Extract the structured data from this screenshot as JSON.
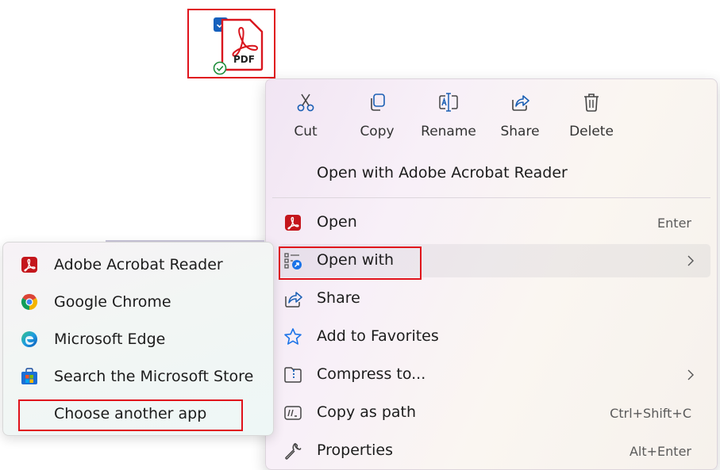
{
  "file": {
    "badge": "PDF"
  },
  "quick_actions": [
    {
      "label": "Cut",
      "icon": "scissors-icon"
    },
    {
      "label": "Copy",
      "icon": "copy-icon"
    },
    {
      "label": "Rename",
      "icon": "rename-icon"
    },
    {
      "label": "Share",
      "icon": "share-icon"
    },
    {
      "label": "Delete",
      "icon": "trash-icon"
    }
  ],
  "menu": {
    "default_action": "Open with Adobe Acrobat Reader",
    "items": [
      {
        "label": "Open",
        "shortcut": "Enter",
        "icon": "acrobat-icon"
      },
      {
        "label": "Open with",
        "shortcut": "",
        "icon": "open-with-icon",
        "has_submenu": true
      },
      {
        "label": "Share",
        "shortcut": "",
        "icon": "share-icon"
      },
      {
        "label": "Add to Favorites",
        "shortcut": "",
        "icon": "star-icon"
      },
      {
        "label": "Compress to...",
        "shortcut": "",
        "icon": "zip-folder-icon",
        "has_submenu": true
      },
      {
        "label": "Copy as path",
        "shortcut": "Ctrl+Shift+C",
        "icon": "path-icon"
      },
      {
        "label": "Properties",
        "shortcut": "Alt+Enter",
        "icon": "wrench-icon"
      }
    ]
  },
  "submenu": {
    "items": [
      {
        "label": "Adobe Acrobat Reader",
        "icon": "acrobat-icon"
      },
      {
        "label": "Google Chrome",
        "icon": "chrome-icon"
      },
      {
        "label": "Microsoft Edge",
        "icon": "edge-icon"
      },
      {
        "label": "Search the Microsoft Store",
        "icon": "store-icon"
      },
      {
        "label": "Choose another app",
        "icon": ""
      }
    ]
  },
  "colors": {
    "accent": "#1560bd",
    "highlight_border": "#e0121b",
    "acrobat_red": "#c4161c"
  }
}
